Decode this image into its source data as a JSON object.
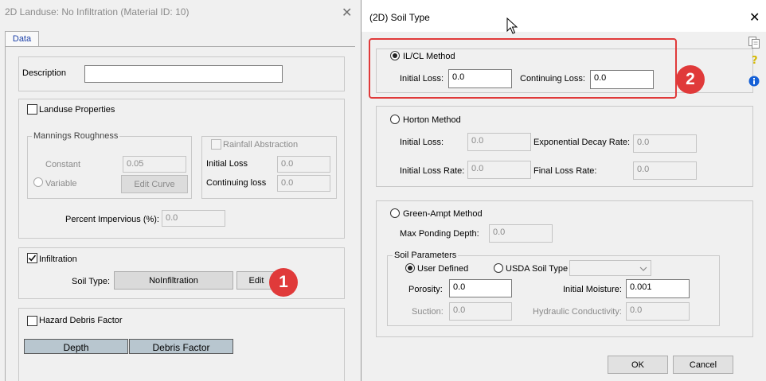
{
  "landuse_dialog": {
    "title": "2D Landuse: No Infiltration (Material ID: 10)",
    "close": "✕",
    "tab_data": "Data",
    "description_label": "Description",
    "description_value": "",
    "landuse_properties_label": "Landuse Properties",
    "mannings_group": "Mannings Roughness",
    "constant_label": "Constant",
    "constant_value": "0.05",
    "variable_label": "Variable",
    "edit_curve": "Edit Curve",
    "rainfall_abstraction_label": "Rainfall Abstraction",
    "initial_loss_label": "Initial Loss",
    "initial_loss_value": "0.0",
    "continuing_loss_label": "Continuing loss",
    "continuing_loss_value": "0.0",
    "percent_impervious_label": "Percent Impervious (%):",
    "percent_impervious_value": "0.0",
    "infiltration_label": "Infiltration",
    "soil_type_label": "Soil Type:",
    "soil_type_value": "NoInfiltration",
    "edit_button": "Edit",
    "hazard_label": "Hazard Debris Factor",
    "hazard_columns": [
      "Depth",
      "Debris Factor"
    ]
  },
  "soil_dialog": {
    "title": "(2D) Soil Type",
    "close": "✕",
    "ilcl_method": "IL/CL Method",
    "ilcl_initial_loss_label": "Initial Loss:",
    "ilcl_initial_loss_value": "0.0",
    "ilcl_continuing_loss_label": "Continuing Loss:",
    "ilcl_continuing_loss_value": "0.0",
    "horton_method": "Horton Method",
    "horton_initial_loss_label": "Initial Loss:",
    "horton_initial_loss_value": "0.0",
    "horton_decay_rate_label": "Exponential Decay Rate:",
    "horton_decay_rate_value": "0.0",
    "horton_initial_loss_rate_label": "Initial Loss Rate:",
    "horton_initial_loss_rate_value": "0.0",
    "horton_final_loss_rate_label": "Final Loss Rate:",
    "horton_final_loss_rate_value": "0.0",
    "green_ampt_method": "Green-Ampt Method",
    "max_ponding_depth_label": "Max Ponding Depth:",
    "max_ponding_depth_value": "0.0",
    "soil_parameters_group": "Soil Parameters",
    "user_defined_label": "User Defined",
    "usda_soil_type_label": "USDA Soil Type",
    "usda_soil_type_value": "",
    "porosity_label": "Porosity:",
    "porosity_value": "0.0",
    "initial_moisture_label": "Initial Moisture:",
    "initial_moisture_value": "0.001",
    "suction_label": "Suction:",
    "suction_value": "0.0",
    "hydraulic_conductivity_label": "Hydraulic Conductivity:",
    "hydraulic_conductivity_value": "0.0",
    "ok_button": "OK",
    "cancel_button": "Cancel"
  },
  "annotations": {
    "badge_1": "1",
    "badge_2": "2",
    "highlight_color": "#e03a3a"
  },
  "colors": {
    "tab_text": "#1a3fa8",
    "info_icon": "#1560d6",
    "help_icon": "#d4b800"
  }
}
